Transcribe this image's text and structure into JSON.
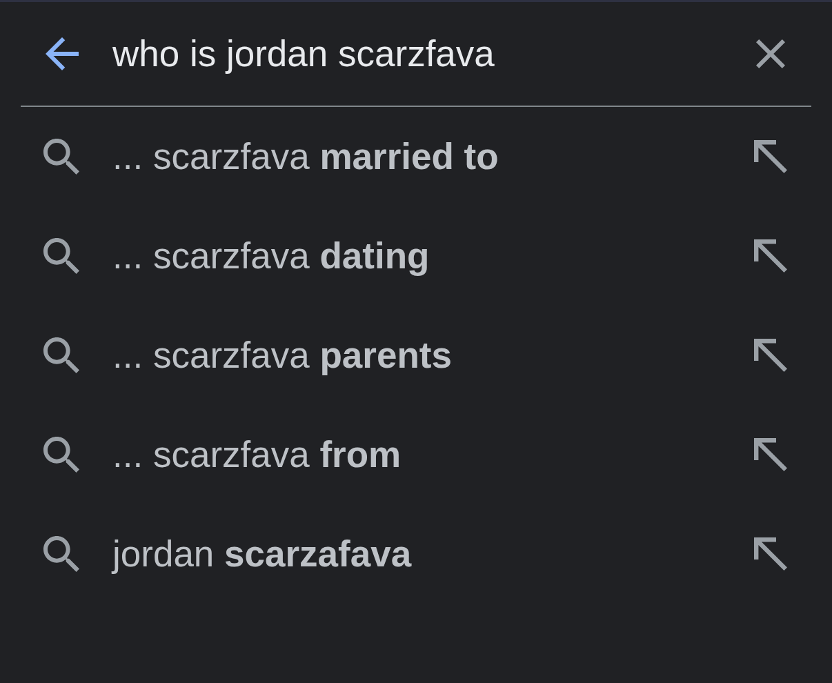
{
  "search": {
    "value": "who is jordan scarzfava"
  },
  "suggestions": [
    {
      "text": "... scarzfava **married to**"
    },
    {
      "text": "... scarzfava **dating**"
    },
    {
      "text": "... scarzfava **parents**"
    },
    {
      "text": "... scarzfava **from**"
    },
    {
      "text": "jordan **scarzafava**"
    }
  ]
}
